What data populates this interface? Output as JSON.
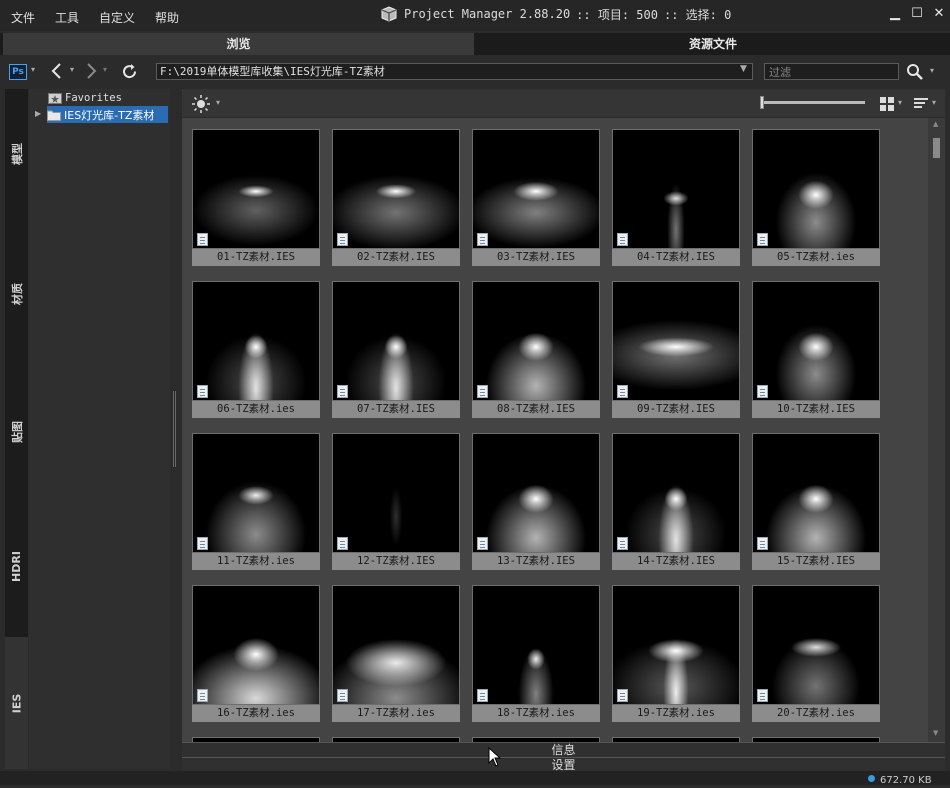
{
  "menu": [
    "文件",
    "工具",
    "自定义",
    "帮助"
  ],
  "title": {
    "app": "Project Manager 2.88.20",
    "items": ":: 项目: 500",
    "selection": ":: 选择: 0"
  },
  "window": {
    "minimize": "▁",
    "maximize": "☐",
    "close": "✕"
  },
  "tabs": {
    "browse": "浏览",
    "assets": "资源文件"
  },
  "toolbar": {
    "ps_badge": "Ps",
    "path": "F:\\2019单体模型库收集\\IES灯光库-TZ素材",
    "filter_placeholder": "过滤"
  },
  "left_tabs": [
    "模型",
    "材质",
    "贴图",
    "HDRI",
    "IES"
  ],
  "tree": {
    "favorites": "Favorites",
    "folder": "IES灯光库-TZ素材"
  },
  "files": [
    {
      "name": "01-TZ素材.IES",
      "style": "a"
    },
    {
      "name": "02-TZ素材.IES",
      "style": "b"
    },
    {
      "name": "03-TZ素材.IES",
      "style": "c"
    },
    {
      "name": "04-TZ素材.IES",
      "style": "d"
    },
    {
      "name": "05-TZ素材.ies",
      "style": "e"
    },
    {
      "name": "06-TZ素材.ies",
      "style": "f"
    },
    {
      "name": "07-TZ素材.IES",
      "style": "f"
    },
    {
      "name": "08-TZ素材.IES",
      "style": "g"
    },
    {
      "name": "09-TZ素材.IES",
      "style": "h"
    },
    {
      "name": "10-TZ素材.IES",
      "style": "e"
    },
    {
      "name": "11-TZ素材.ies",
      "style": "i"
    },
    {
      "name": "12-TZ素材.IES",
      "style": "j"
    },
    {
      "name": "13-TZ素材.IES",
      "style": "g"
    },
    {
      "name": "14-TZ素材.IES",
      "style": "f"
    },
    {
      "name": "15-TZ素材.IES",
      "style": "g"
    },
    {
      "name": "16-TZ素材.ies",
      "style": "k"
    },
    {
      "name": "17-TZ素材.ies",
      "style": "l"
    },
    {
      "name": "18-TZ素材.ies",
      "style": "m"
    },
    {
      "name": "19-TZ素材.ies",
      "style": "n"
    },
    {
      "name": "20-TZ素材.ies",
      "style": "o"
    }
  ],
  "bottom": {
    "info": "信息",
    "settings": "设置",
    "status": "672.70 KB"
  }
}
